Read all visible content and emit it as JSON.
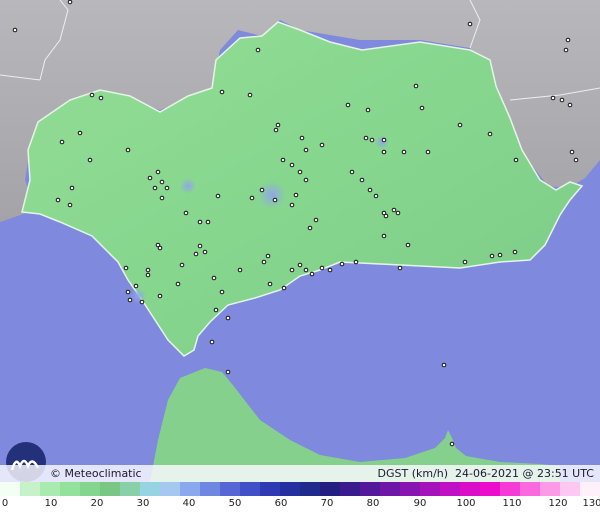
{
  "credit": "© Meteoclimatic",
  "variable": "DGST",
  "unit": "(km/h)",
  "date": "24-06-2021",
  "time_sep": "@",
  "time": "23:51 UTC",
  "legend": {
    "ticks": [
      "0",
      "10",
      "20",
      "30",
      "40",
      "50",
      "60",
      "70",
      "80",
      "90",
      "100",
      "110",
      "120",
      "130"
    ],
    "colors": [
      "#f2fff2",
      "#c6f2c9",
      "#a9eab0",
      "#92e29c",
      "#84d68e",
      "#7ac684",
      "#88d0a8",
      "#96d4e4",
      "#a4c8f0",
      "#8aa8ee",
      "#6e88e2",
      "#5666d4",
      "#4050c6",
      "#2e3ab4",
      "#2430a0",
      "#1e2a8c",
      "#241e80",
      "#3a1a8c",
      "#54189a",
      "#6e16a6",
      "#8814b2",
      "#a412bc",
      "#c010c6",
      "#d80ec8",
      "#ec0ccc",
      "#f63ad6",
      "#fa6ade",
      "#fc9ae8",
      "#fec8f2",
      "#fff0fa"
    ]
  }
}
